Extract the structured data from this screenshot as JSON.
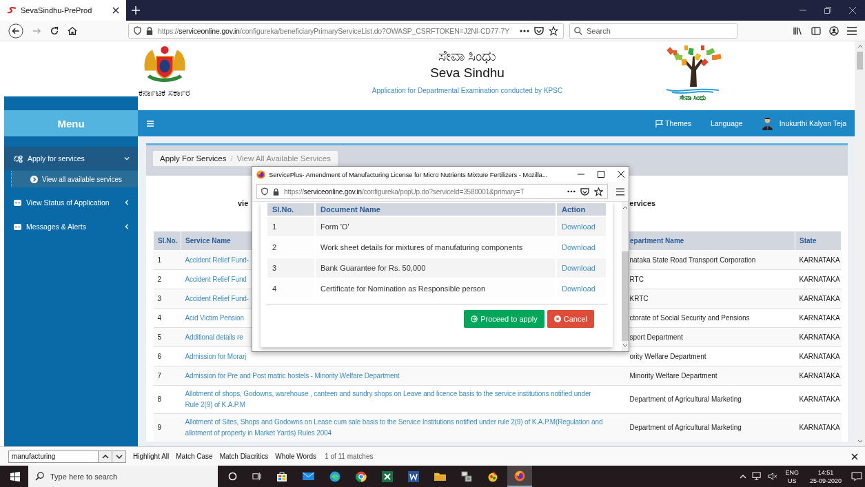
{
  "browser": {
    "tab_title": "SevaSindhu-PreProd",
    "url": {
      "scheme": "https://",
      "host": "serviceonline.gov.in",
      "path": "/configureka/beneficiaryPrimaryServiceList.do?OWASP_CSRFTOKEN=J2NI-CD77-7Y"
    },
    "search_placeholder": "Search"
  },
  "header": {
    "state_name": "ಕರ್ನಾಟಕ ಸರ್ಕಾರ",
    "title_kannada": "ಸೇವಾ ಸಿಂಧು",
    "title": "Seva Sindhu",
    "subtitle": "Application for Departmental Examination conducted by KPSC",
    "logo_text": "ಸೇವಾ ಸಿಂಧು"
  },
  "sidebar": {
    "title": "Menu",
    "items": [
      {
        "label": "Apply for services",
        "expanded": true,
        "selected": true,
        "children": [
          {
            "label": "View all available services",
            "selected": true
          }
        ]
      },
      {
        "label": "View Status of Application",
        "expanded": false,
        "selected": false
      },
      {
        "label": "Messages & Alerts",
        "expanded": false,
        "selected": false
      }
    ]
  },
  "topbar": {
    "themes": "Themes",
    "language": "Language",
    "user": "Inukurthi Kalyan Teja"
  },
  "breadcrumb": {
    "separator": "/",
    "items": [
      {
        "label": "Apply For Services"
      },
      {
        "label": "View All Available Services"
      }
    ]
  },
  "heading": {
    "left": "vie",
    "right": "ervices"
  },
  "table": {
    "columns": [
      "Sl.No.",
      "Service Name",
      "epartment Name",
      "State"
    ],
    "rows": [
      {
        "no": "1",
        "service": "Accident Relief Fund-",
        "department": "nataka State Road Transport Corporation",
        "state": "KARNATAKA"
      },
      {
        "no": "2",
        "service": "Accident Relief Fund",
        "department": "RTC",
        "state": "KARNATAKA"
      },
      {
        "no": "3",
        "service": "Accident Relief Fund-",
        "department": "KRTC",
        "state": "KARNATAKA"
      },
      {
        "no": "4",
        "service": "Acid Victim Pension",
        "department": "ctorate of Social Security and Pensions",
        "state": "KARNATAKA"
      },
      {
        "no": "5",
        "service": "Additional details re",
        "department": "sport Department",
        "state": "KARNATAKA"
      },
      {
        "no": "6",
        "service": "Admission for Morarj",
        "department": "ority Welfare Department",
        "state": "KARNATAKA"
      },
      {
        "no": "7",
        "service": "Admission for Pre and Post matric hostels - Minority Welfare Department",
        "department": "Minority Welfare Department",
        "state": "KARNATAKA"
      },
      {
        "no": "8",
        "service": "Allotment of shops, Godowns, warehouse , canteen and sundry shops on Leave and licence basis to the service institutions notified under Rule 2(9) of K.A.P.M",
        "department": "Department of Agricultural Marketing",
        "state": "KARNATAKA"
      },
      {
        "no": "9",
        "service": "Allotment of Sites, Shops and Godowns on Lease cum sale basis to the Service Institutions notified under rule 2(9) of K.A.P.M(Regulation and allotment of property in Market Yards) Rules 2004",
        "department": "Department of Agricultural Marketing",
        "state": "KARNATAKA"
      }
    ]
  },
  "popup": {
    "title": "ServicePlus- Amendment of Manufacturing License for Micro Nutrients Mixture Fertilizers - Mozilla...",
    "url": {
      "scheme": "https://",
      "host": "serviceonline.gov.in",
      "path": "/configureka/popUp.do?serviceId=3580001&primary=T"
    },
    "columns": [
      "Sl.No.",
      "Document Name",
      "Action"
    ],
    "rows": [
      {
        "no": "1",
        "name": "Form 'O'",
        "action": "Download"
      },
      {
        "no": "2",
        "name": "Work sheet details for mixtures of manufaturing components",
        "action": "Download"
      },
      {
        "no": "3",
        "name": "Bank Guarantee for Rs. 50,000",
        "action": "Download"
      },
      {
        "no": "4",
        "name": "Certificate for Nomination as Responsible person",
        "action": "Download"
      }
    ],
    "buttons": [
      {
        "kind": "proceed",
        "label": "Proceed to apply"
      },
      {
        "kind": "cancel",
        "label": "Cancel"
      }
    ]
  },
  "find_bar": {
    "value": "manufacturing",
    "options": [
      "Highlight All",
      "Match Case",
      "Match Diacritics",
      "Whole Words"
    ],
    "result": "1 of 11 matches"
  },
  "taskbar": {
    "search_placeholder": "Type here to search",
    "language": "ENG",
    "region": "US",
    "time": "14:51",
    "date": "25-09-2020"
  }
}
